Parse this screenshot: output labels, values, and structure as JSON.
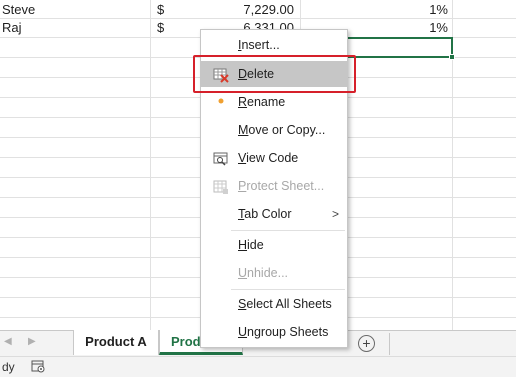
{
  "rows": [
    {
      "name": "Steve",
      "currency": "$",
      "amount": "7,229.00",
      "percent": "1%"
    },
    {
      "name": "Raj",
      "currency": "$",
      "amount": "6,331.00",
      "percent": "1%"
    }
  ],
  "context_menu": {
    "items": [
      {
        "label": "Insert...",
        "underline": "I",
        "rest": "nsert...",
        "icon": "none",
        "enabled": true
      },
      {
        "label": "Delete",
        "underline": "D",
        "rest": "elete",
        "icon": "delete-sheet-icon",
        "enabled": true,
        "highlighted": true
      },
      {
        "label": "Rename",
        "underline": "R",
        "rest": "ename",
        "icon": "bullet-dot-icon",
        "enabled": true
      },
      {
        "label": "Move or Copy...",
        "underline": "M",
        "rest": "ove or Copy...",
        "icon": "none",
        "enabled": true
      },
      {
        "label": "View Code",
        "underline": "V",
        "rest": "iew Code",
        "icon": "view-code-icon",
        "enabled": true
      },
      {
        "label": "Protect Sheet...",
        "underline": "P",
        "rest": "rotect Sheet...",
        "icon": "protect-sheet-icon",
        "enabled": false
      },
      {
        "label": "Tab Color",
        "underline": "T",
        "rest": "ab Color",
        "icon": "none",
        "enabled": true,
        "submenu": true
      },
      {
        "label": "Hide",
        "underline": "H",
        "rest": "ide",
        "icon": "none",
        "enabled": true
      },
      {
        "label": "Unhide...",
        "underline": "U",
        "rest": "nhide...",
        "icon": "none",
        "enabled": false
      },
      {
        "label": "Select All Sheets",
        "underline": "S",
        "rest": "elect All Sheets",
        "icon": "none",
        "enabled": true
      },
      {
        "label": "Ungroup Sheets",
        "underline": "U",
        "rest": "ngroup Sheets",
        "icon": "none",
        "enabled": true
      }
    ],
    "submenu_arrow": ">"
  },
  "sheet_tabs": {
    "tabs": [
      {
        "label": "Product A",
        "active": false
      },
      {
        "label": "Prod",
        "active": true
      }
    ],
    "add_sheet_symbol": "+",
    "prev_arrow": "◀",
    "next_arrow": "▶"
  },
  "status_bar": {
    "ready_text": "dy"
  },
  "colors": {
    "excel_green": "#217346",
    "highlight_red": "#d6202a",
    "menu_hover": "#c6c6c6",
    "rename_dot": "#f0a030"
  }
}
